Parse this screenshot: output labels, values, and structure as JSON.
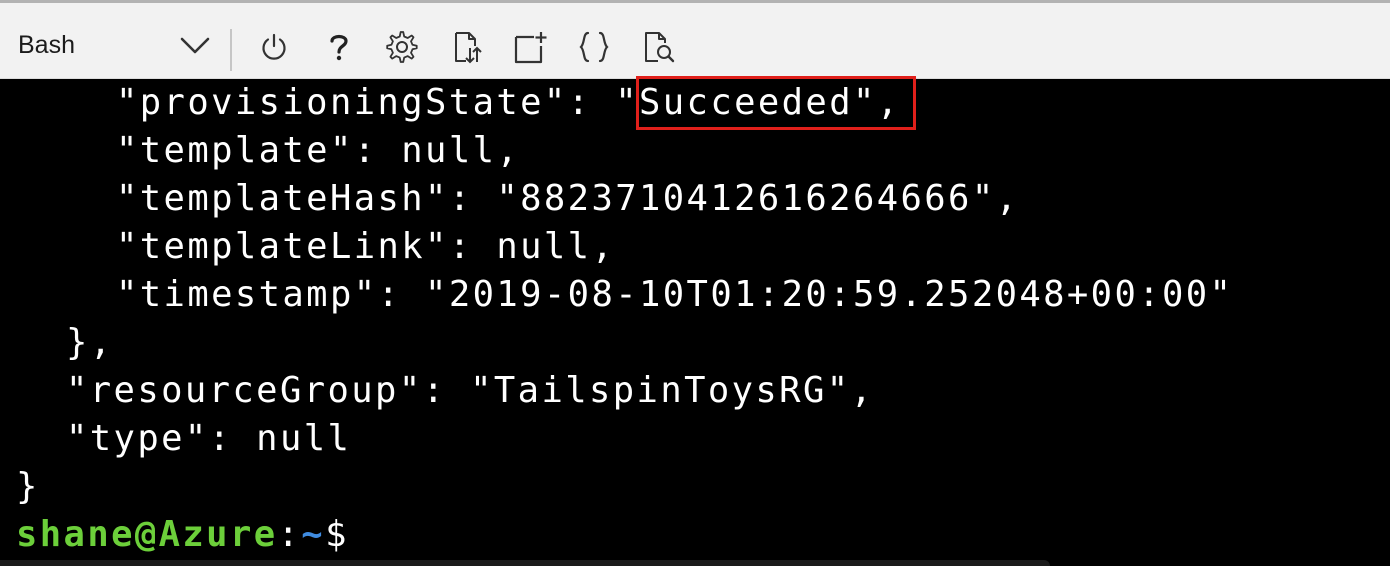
{
  "toolbar": {
    "shell_selected": "Bash",
    "buttons": [
      {
        "id": "restart",
        "icon": "power-icon"
      },
      {
        "id": "help",
        "icon": "question-icon"
      },
      {
        "id": "settings",
        "icon": "gear-icon"
      },
      {
        "id": "upload-download",
        "icon": "upload-download-icon"
      },
      {
        "id": "new-session",
        "icon": "new-session-icon"
      },
      {
        "id": "editor",
        "icon": "braces-icon"
      },
      {
        "id": "web-preview",
        "icon": "web-preview-icon"
      }
    ]
  },
  "terminal": {
    "lines": {
      "provisioning_key": "\"provisioningState\": ",
      "provisioning_value": "\"Succeeded\"",
      "provisioning_comma": ",",
      "template": "\"template\": null,",
      "template_hash": "\"templateHash\": \"8823710412616264666\",",
      "template_link": "\"templateLink\": null,",
      "timestamp": "\"timestamp\": \"2019-08-10T01:20:59.252048+00:00\"",
      "close_props": "},",
      "resource_group": "\"resourceGroup\": \"TailspinToysRG\",",
      "type": "\"type\": null",
      "close_root": "}"
    },
    "prompt": {
      "user_host": "shane@Azure",
      "colon": ":",
      "path": "~",
      "symbol": "$"
    }
  },
  "colors": {
    "highlight_border": "#e0201b",
    "prompt_user": "#6ccf3a",
    "prompt_path": "#3f8be0",
    "terminal_bg": "#000000",
    "toolbar_bg": "#f2f2f2"
  }
}
